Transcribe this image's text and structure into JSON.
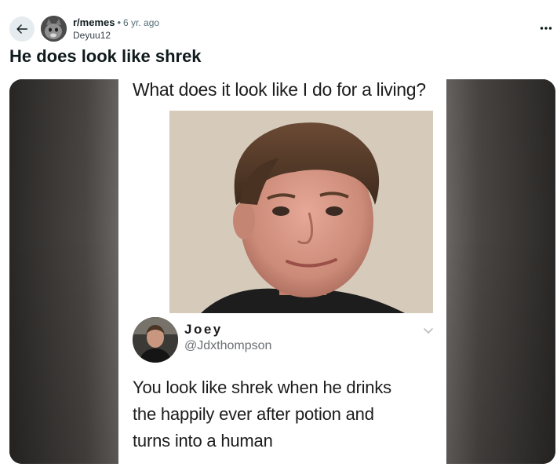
{
  "header": {
    "back_icon": "arrow-left-icon",
    "subreddit": "r/memes",
    "separator": "•",
    "time_ago": "6 yr. ago",
    "username": "Deyuu12",
    "more_icon": "ellipsis-icon",
    "more_label": "..."
  },
  "post": {
    "title": "He does look like shrek"
  },
  "meme": {
    "question": "What does it look like I do for a living?",
    "tweet": {
      "name": "Joey",
      "handle": "@Jdxthompson",
      "chevron_icon": "chevron-down-icon",
      "text_lines": [
        "You look like shrek when he drinks",
        "the happily ever after potion and",
        "turns into a human"
      ]
    }
  },
  "colors": {
    "back_button_bg": "#e5ebee",
    "text_primary": "#0f1a1c",
    "text_secondary": "#576f76",
    "media_bg": "#2e2c2a"
  }
}
